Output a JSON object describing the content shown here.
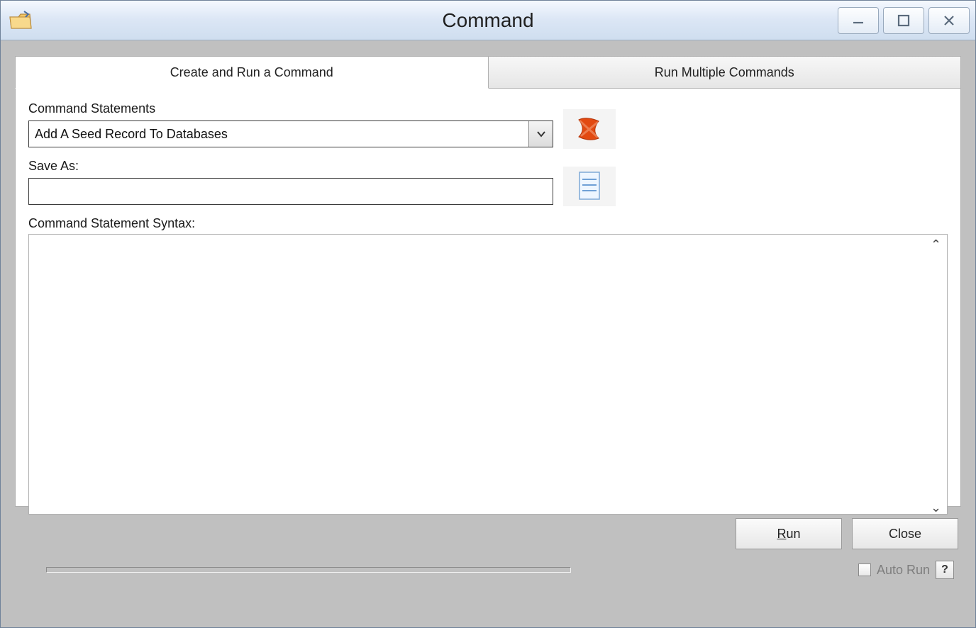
{
  "window": {
    "title": "Command"
  },
  "tabs": {
    "create": "Create and Run a Command",
    "multiple": "Run Multiple Commands"
  },
  "form": {
    "command_statements_label": "Command Statements",
    "command_statements_value": "Add A Seed Record To Databases",
    "save_as_label": "Save As:",
    "save_as_value": "",
    "syntax_label": "Command Statement Syntax:",
    "syntax_value": ""
  },
  "buttons": {
    "run": "Run",
    "run_mn": "R",
    "run_rest": "un",
    "close": "Close"
  },
  "status": {
    "auto_run": "Auto Run",
    "help": "?"
  },
  "icons": {
    "app": "folder-tools-icon",
    "delete": "delete-x-icon",
    "save": "save-doc-icon"
  }
}
